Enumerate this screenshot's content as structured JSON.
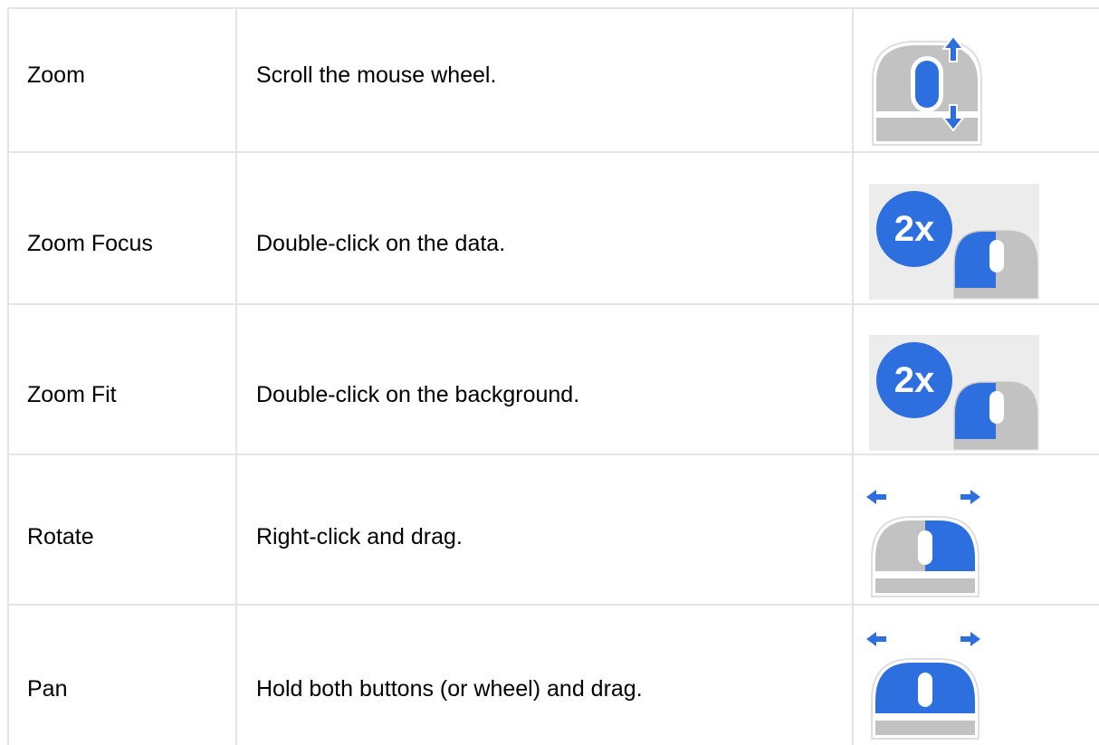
{
  "rows": [
    {
      "action": "Zoom",
      "description": "Scroll the mouse wheel.",
      "icon": "mouse-scroll-wheel-icon"
    },
    {
      "action": "Zoom Focus",
      "description": "Double-click on the data.",
      "icon": "double-click-2x-icon",
      "badge": "2x"
    },
    {
      "action": "Zoom Fit",
      "description": "Double-click on the background.",
      "icon": "double-click-2x-icon",
      "badge": "2x"
    },
    {
      "action": "Rotate",
      "description": "Right-click and drag.",
      "icon": "mouse-right-drag-icon"
    },
    {
      "action": "Pan",
      "description": "Hold both buttons (or wheel) and drag.",
      "icon": "mouse-both-drag-icon"
    }
  ],
  "colors": {
    "accent": "#2e6fe0",
    "mouse_gray": "#c2c2c2",
    "icon_bg": "#ececec",
    "grid": "#e4e4e4"
  }
}
